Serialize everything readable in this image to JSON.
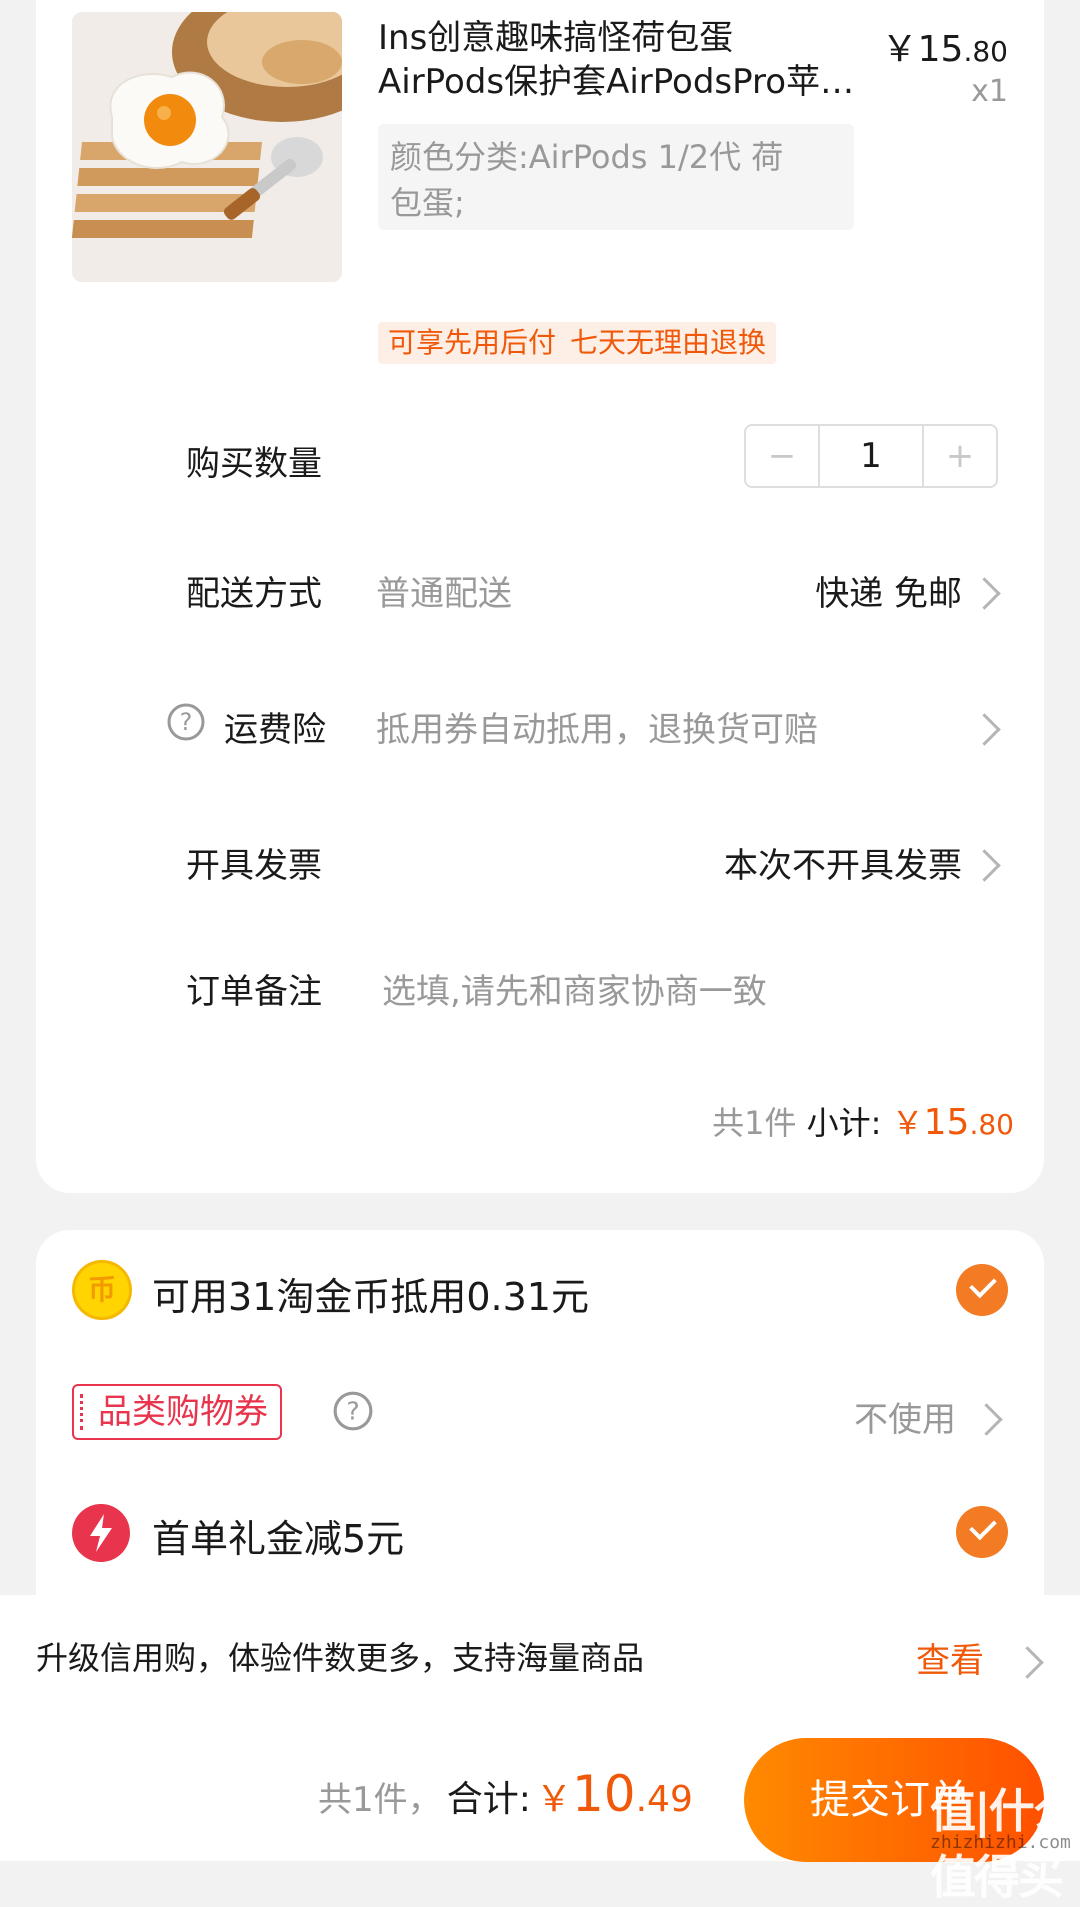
{
  "product": {
    "title_line1": "Ins创意趣味搞怪荷包蛋",
    "title_line2": "AirPods保护套AirPodsPro苹果耳机套",
    "sku_line1": "颜色分类:AirPods 1/2代 荷",
    "sku_line2": "包蛋;",
    "currency": "￥",
    "price_int": "15",
    "price_dec": ".80",
    "quantity_label": "x1",
    "tags": [
      "可享先用后付",
      "七天无理由退换"
    ]
  },
  "order": {
    "quantity_label": "购买数量",
    "quantity_value": "1",
    "minus": "−",
    "plus": "+",
    "delivery_label": "配送方式",
    "delivery_type": "普通配送",
    "delivery_value": "快递 免邮",
    "insurance_label": "运费险",
    "insurance_hint": "抵用券自动抵用，退换货可赔",
    "invoice_label": "开具发票",
    "invoice_value": "本次不开具发票",
    "note_label": "订单备注",
    "note_placeholder": "选填,请先和商家协商一致",
    "subtotal_count": "共1件",
    "subtotal_label": "小计:",
    "subtotal_currency": "￥",
    "subtotal_int": "15",
    "subtotal_dec": ".80"
  },
  "discounts": {
    "coins_text": "可用31淘金币抵用0.31元",
    "coin_symbol": "币",
    "coupon_label": "品类购物券",
    "coupon_value": "不使用",
    "first_order_text": "首单礼金减5元"
  },
  "upgrade": {
    "text": "升级信用购，体验件数更多，支持海量商品",
    "link": "查看"
  },
  "footer": {
    "count": "共1件，",
    "total_label": "合计:",
    "currency": "￥",
    "total_int": "10",
    "total_dec": ".49",
    "submit": "提交订单"
  },
  "watermark": {
    "main": "值|什么值得买",
    "sub": "zhizhizhi.com"
  },
  "colors": {
    "accent": "#f1590a",
    "check": "#f27b23",
    "coupon_red": "#e8344c"
  }
}
